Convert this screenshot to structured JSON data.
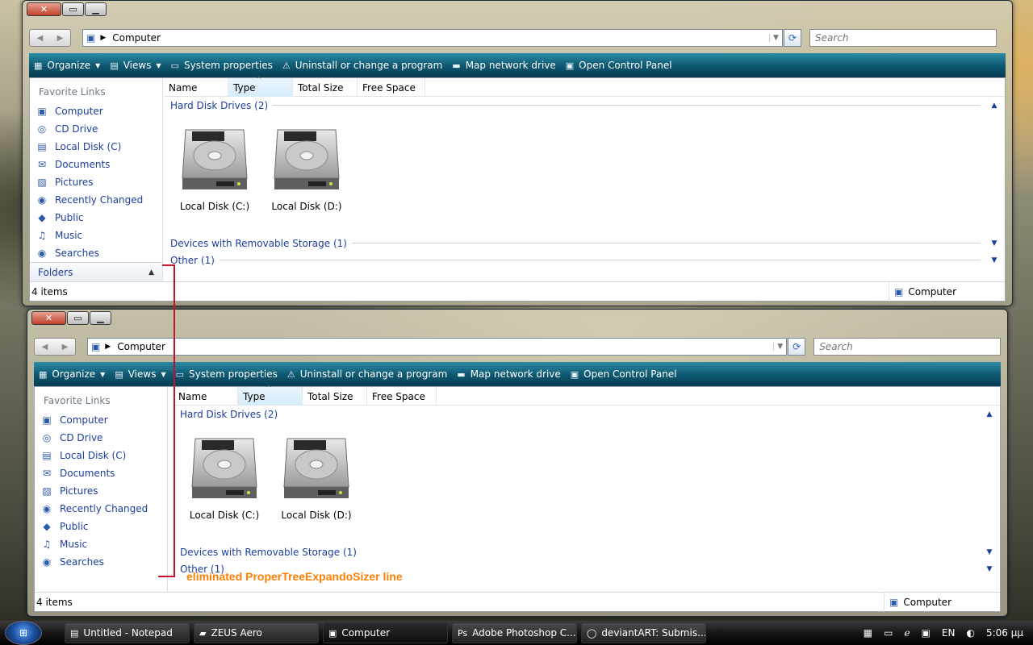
{
  "explorer": {
    "address": "Computer",
    "search_placeholder": "Search",
    "commands": {
      "organize": "Organize",
      "views": "Views",
      "system_properties": "System properties",
      "uninstall": "Uninstall or change a program",
      "map_drive": "Map network drive",
      "control_panel": "Open Control Panel"
    },
    "favorite_links_title": "Favorite Links",
    "links": [
      "Computer",
      "CD Drive",
      "Local Disk (C)",
      "Documents",
      "Pictures",
      "Recently Changed",
      "Public",
      "Music",
      "Searches"
    ],
    "folders_label": "Folders",
    "columns": [
      "Name",
      "Type",
      "Total Size",
      "Free Space"
    ],
    "groups": {
      "hard_disk": "Hard Disk Drives (2)",
      "removable": "Devices with Removable Storage (1)",
      "other": "Other (1)"
    },
    "drives": [
      "Local Disk (C:)",
      "Local Disk (D:)"
    ],
    "status_items": "4 items",
    "status_location": "Computer"
  },
  "annotation": "eliminated ProperTreeExpandoSizer line",
  "taskbar": {
    "tasks": [
      "Untitled - Notepad",
      "ZEUS Aero",
      "Computer",
      "Adobe Photoshop C...",
      "deviantART: Submis..."
    ],
    "language": "EN",
    "clock": "5:06 μμ"
  },
  "colors": {
    "link": "#1b3e9c",
    "command_bar": "#0f5a74",
    "annotation": "#ff7f00",
    "annotation_line": "#c8102e"
  }
}
